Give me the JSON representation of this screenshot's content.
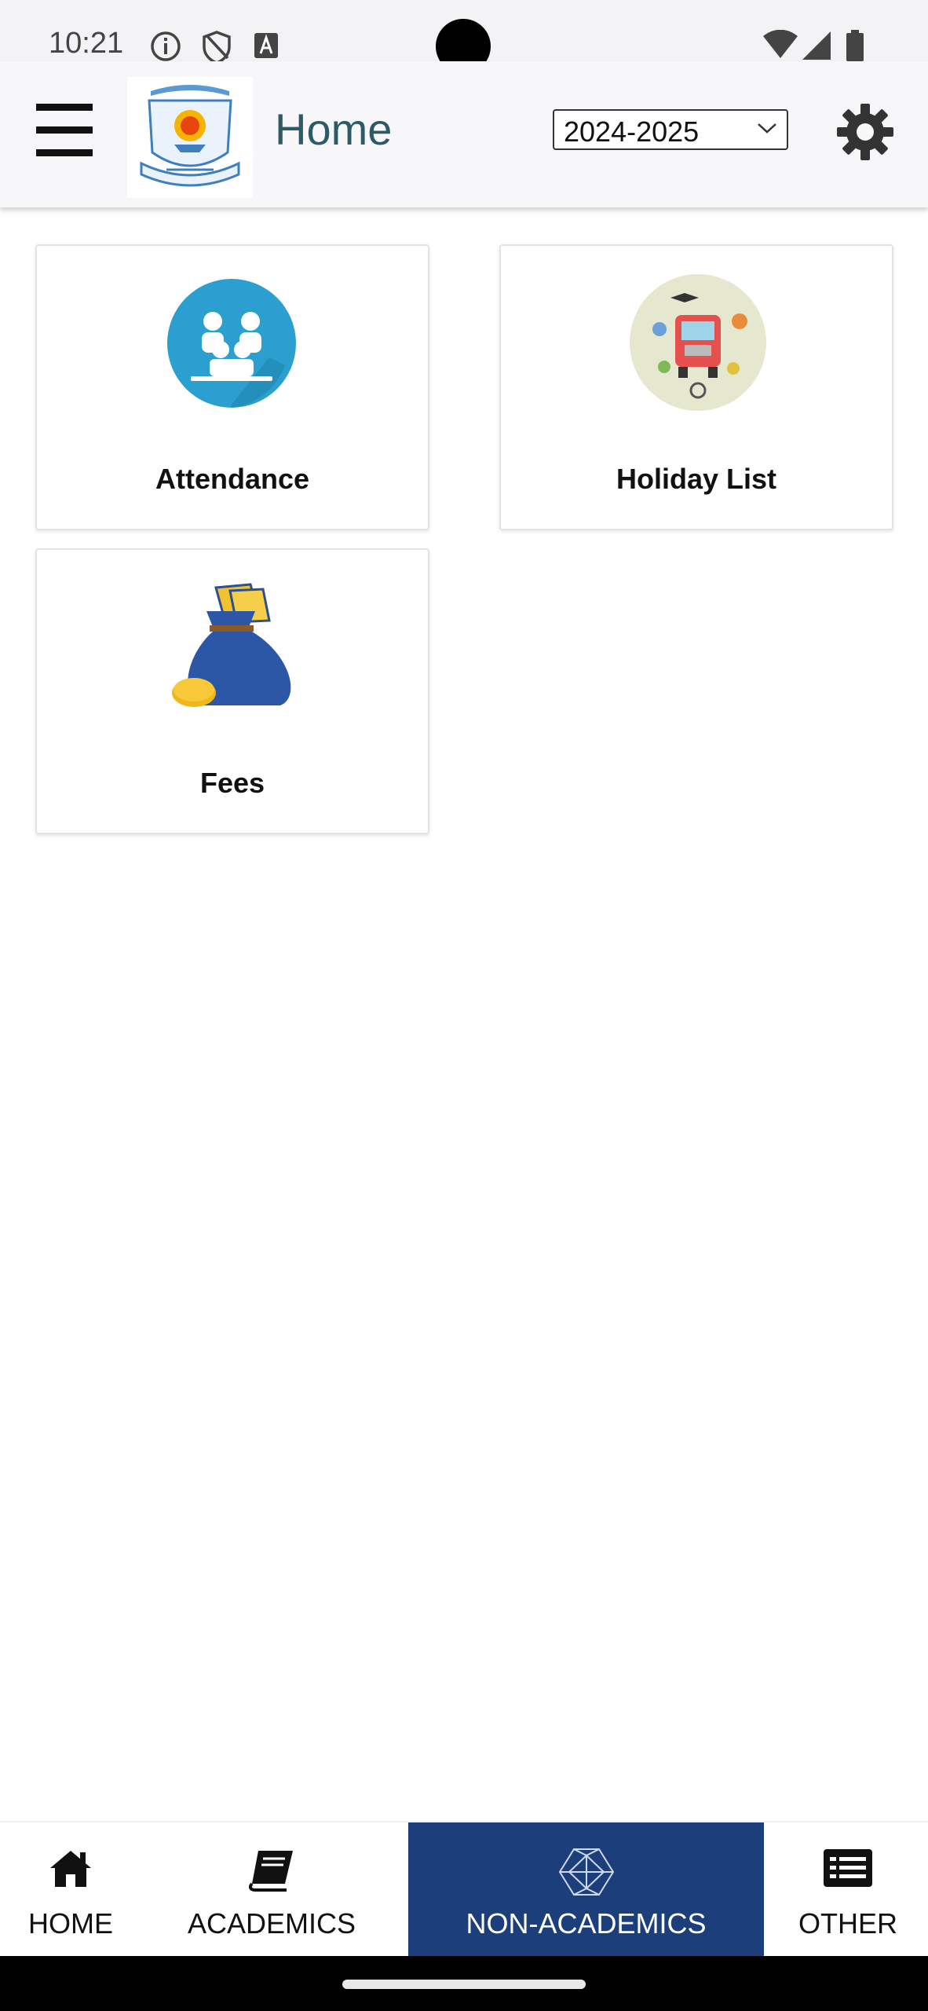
{
  "status_bar": {
    "time": "10:21",
    "icons": [
      "info-icon",
      "shield-icon",
      "font-icon",
      "wifi-icon",
      "signal-icon",
      "battery-icon"
    ]
  },
  "app_bar": {
    "menu_icon": "hamburger-icon",
    "logo_icon": "school-logo",
    "title": "Home",
    "year_select": {
      "value": "2024-2025"
    },
    "settings_icon": "gear-icon"
  },
  "cards": [
    {
      "label": "Attendance",
      "icon": "attendance-icon"
    },
    {
      "label": "Holiday List",
      "icon": "holiday-bus-icon"
    },
    {
      "label": "Fees",
      "icon": "money-bag-icon"
    }
  ],
  "bottom_nav": {
    "items": [
      {
        "label": "HOME",
        "icon": "home-icon"
      },
      {
        "label": "ACADEMICS",
        "icon": "book-icon"
      },
      {
        "label": "NON-ACADEMICS",
        "icon": "polyhedron-icon"
      },
      {
        "label": "OTHER",
        "icon": "list-icon"
      }
    ],
    "active_index": 2,
    "active_color": "#1c3f7c"
  }
}
